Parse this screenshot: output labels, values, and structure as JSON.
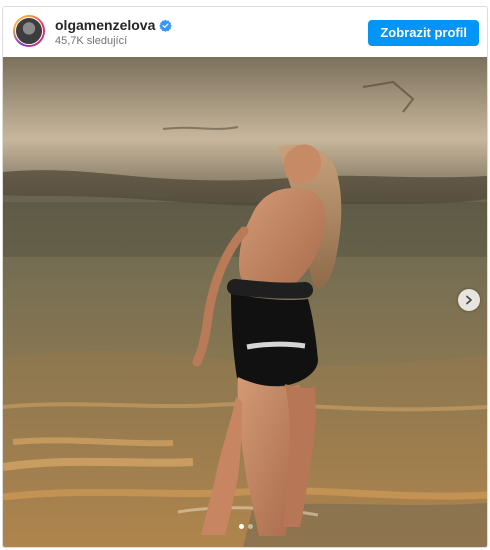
{
  "post": {
    "username": "olgamenzelova",
    "followers": "45,7K sledující",
    "profile_button": "Zobrazit profil",
    "verified": true,
    "carousel": {
      "current_slide": 1,
      "total_slides": 2
    }
  },
  "icons": {
    "verified": "verified-badge-icon",
    "next": "chevron-right-icon"
  },
  "colors": {
    "accent": "#0095f6",
    "verified": "#3897f0"
  }
}
